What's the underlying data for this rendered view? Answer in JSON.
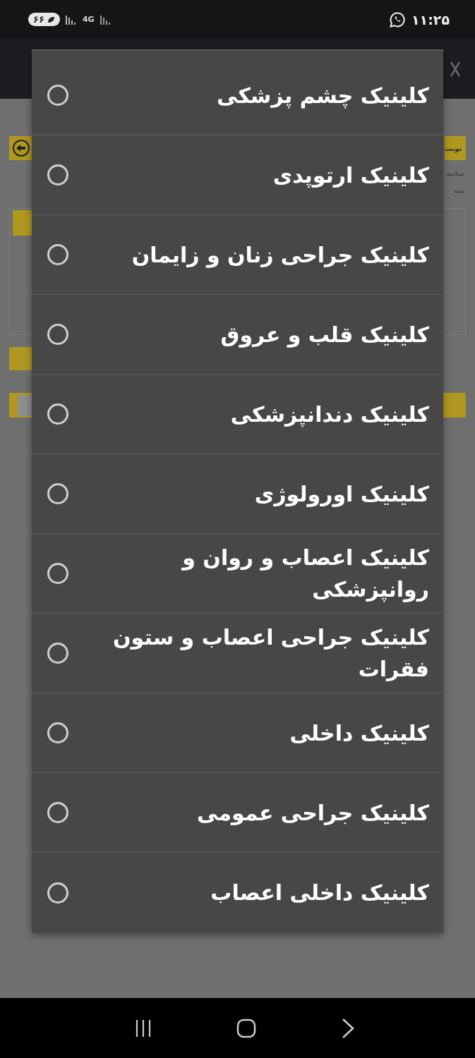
{
  "status_bar": {
    "battery": "۶۶",
    "network": "4G",
    "time": "۱۱:۲۵"
  },
  "page": {
    "tab_label": "نوبت",
    "field_labels": [
      "شناسه",
      "بیمه"
    ]
  },
  "dialog": {
    "options": [
      {
        "label": "کلینیک چشم پزشکی",
        "selected": false
      },
      {
        "label": "کلینیک ارتوپدی",
        "selected": false
      },
      {
        "label": "کلینیک جراحی زنان و زایمان",
        "selected": false
      },
      {
        "label": "کلینیک قلب و عروق",
        "selected": false
      },
      {
        "label": "کلینیک دندانپزشکی",
        "selected": false
      },
      {
        "label": "کلینیک اورولوژی",
        "selected": false
      },
      {
        "label": "کلینیک اعصاب و روان و روانپزشکی",
        "selected": false
      },
      {
        "label": "کلینیک جراحی اعصاب و ستون فقرات",
        "selected": false
      },
      {
        "label": "کلینیک داخلی",
        "selected": false
      },
      {
        "label": "کلینیک جراحی عمومی",
        "selected": false
      },
      {
        "label": "کلینیک داخلی اعصاب",
        "selected": false
      }
    ]
  }
}
